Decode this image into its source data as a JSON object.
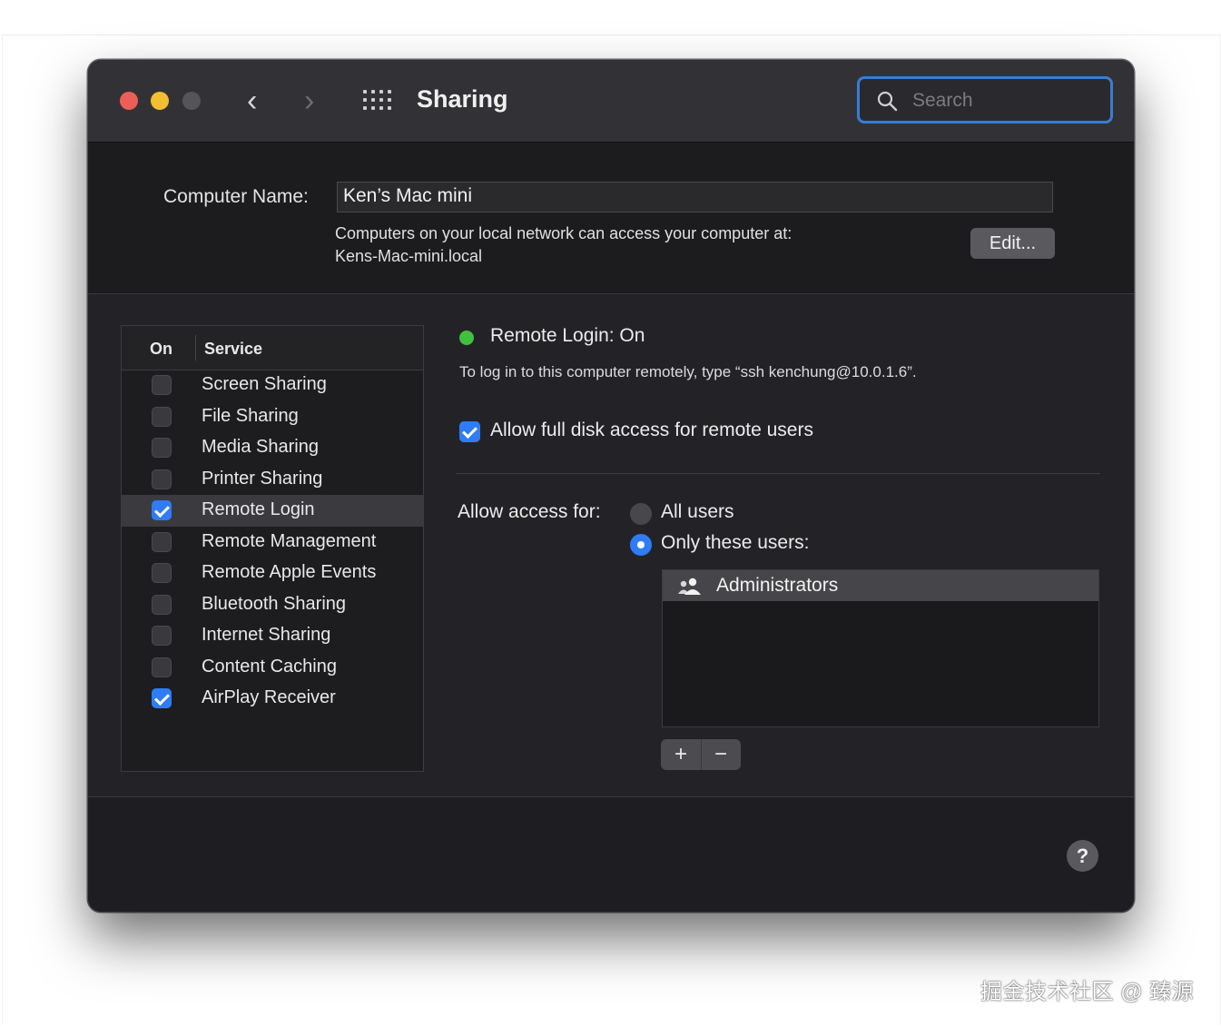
{
  "window": {
    "title": "Sharing",
    "search": {
      "placeholder": "Search",
      "value": ""
    }
  },
  "computer_name": {
    "label": "Computer Name:",
    "value": "Ken’s Mac mini",
    "description_line1": "Computers on your local network can access your computer at:",
    "description_line2": "Kens-Mac-mini.local",
    "edit_label": "Edit..."
  },
  "services": {
    "header_on": "On",
    "header_service": "Service",
    "items": [
      {
        "label": "Screen Sharing",
        "checked": false,
        "selected": false
      },
      {
        "label": "File Sharing",
        "checked": false,
        "selected": false
      },
      {
        "label": "Media Sharing",
        "checked": false,
        "selected": false
      },
      {
        "label": "Printer Sharing",
        "checked": false,
        "selected": false
      },
      {
        "label": "Remote Login",
        "checked": true,
        "selected": true
      },
      {
        "label": "Remote Management",
        "checked": false,
        "selected": false
      },
      {
        "label": "Remote Apple Events",
        "checked": false,
        "selected": false
      },
      {
        "label": "Bluetooth Sharing",
        "checked": false,
        "selected": false
      },
      {
        "label": "Internet Sharing",
        "checked": false,
        "selected": false
      },
      {
        "label": "Content Caching",
        "checked": false,
        "selected": false
      },
      {
        "label": "AirPlay Receiver",
        "checked": true,
        "selected": false
      }
    ]
  },
  "detail": {
    "status": "Remote Login: On",
    "status_color": "#3fc13e",
    "hint": "To log in to this computer remotely, type “ssh kenchung@10.0.1.6”.",
    "full_disk_label": "Allow full disk access for remote users",
    "full_disk_checked": true,
    "access_label": "Allow access for:",
    "option_all": "All users",
    "option_only": "Only these users:",
    "selected_option": "only",
    "users": [
      "Administrators"
    ],
    "add_label": "+",
    "remove_label": "−"
  },
  "help_label": "?",
  "watermark": "掘金技术社区 @ 臻源",
  "colors": {
    "accent": "#2f7cf6",
    "close": "#ec5f57",
    "minimize": "#f3be2f"
  }
}
